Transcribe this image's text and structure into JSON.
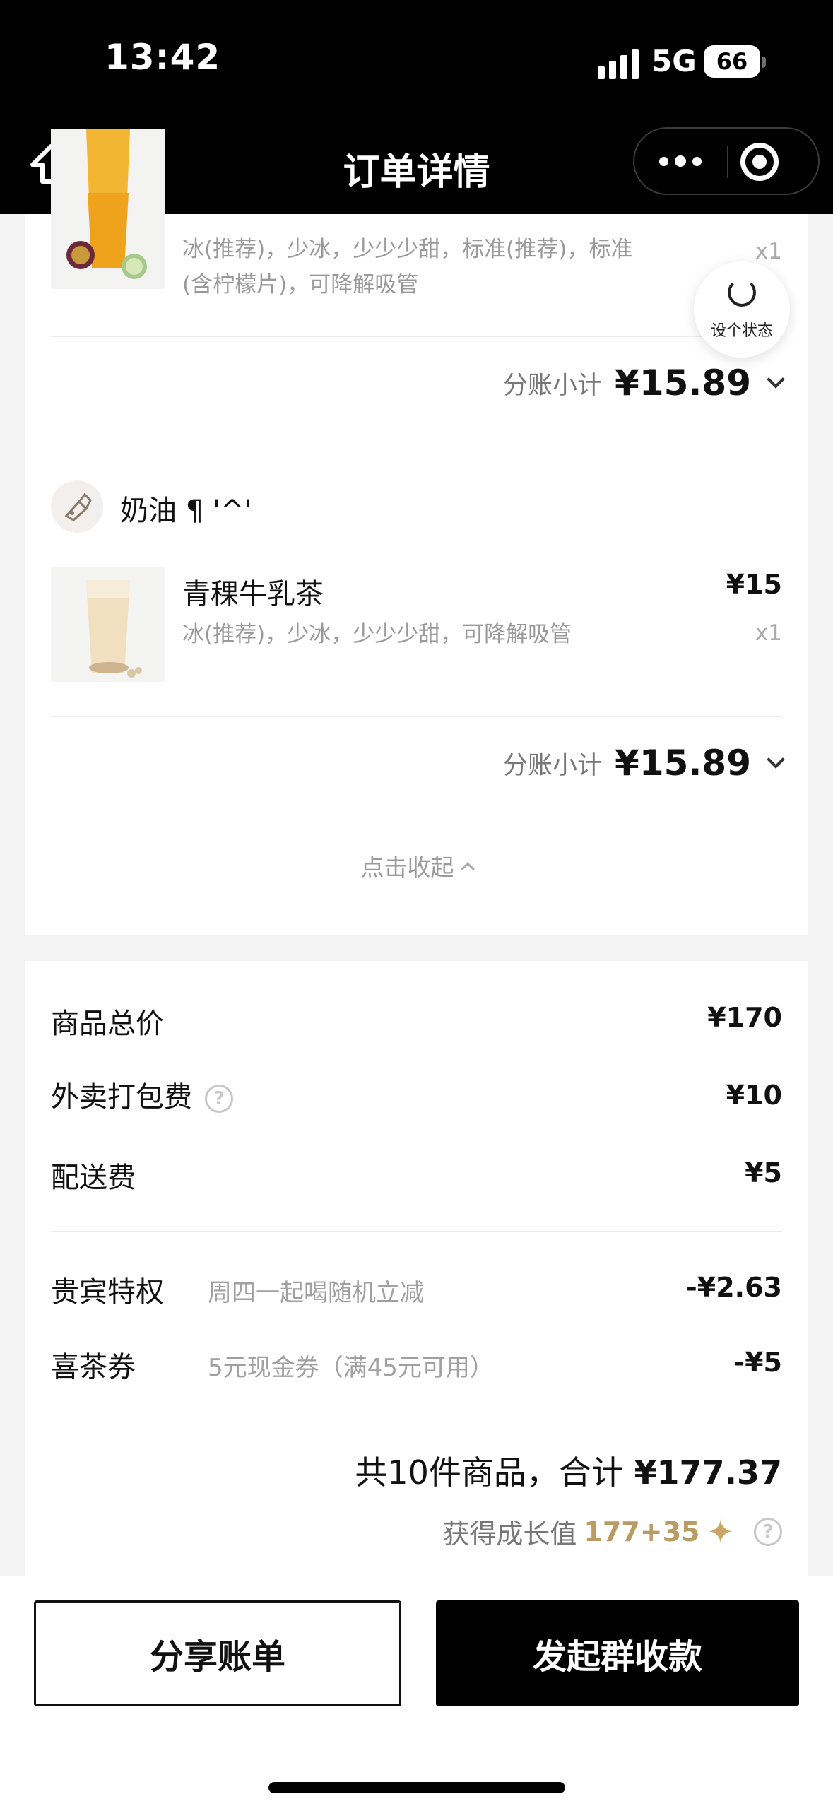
{
  "status_bar": {
    "time": "13:42",
    "network": "5G",
    "battery": "66"
  },
  "nav": {
    "title": "订单详情",
    "home_icon": "home-icon",
    "more_icon": "more-dots-icon",
    "close_icon": "target-close-icon"
  },
  "order": {
    "first_item": {
      "options_line1": "冰(推荐)，少冰，少少少甜，标准(推荐)，标准",
      "options_line2": "(含柠檬片)，可降解吸管",
      "qty": "x1"
    },
    "subtotal1": {
      "label": "分账小计",
      "value": "¥15.89"
    },
    "member": {
      "name": "奶油 ¶ '^'"
    },
    "second_item": {
      "name": "青稞牛乳茶",
      "price": "¥15",
      "options": "冰(推荐)，少冰，少少少甜，可降解吸管",
      "qty": "x1"
    },
    "subtotal2": {
      "label": "分账小计",
      "value": "¥15.89"
    },
    "collapse_label": "点击收起"
  },
  "floating_status": {
    "label": "设个状态"
  },
  "summary": {
    "goods_total": {
      "label": "商品总价",
      "value": "¥170"
    },
    "packing_fee": {
      "label": "外卖打包费",
      "value": "¥10",
      "help": "?"
    },
    "delivery_fee": {
      "label": "配送费",
      "value": "¥5"
    },
    "vip_privilege": {
      "label": "贵宾特权",
      "desc": "周四一起喝随机立减",
      "value": "-¥2.63"
    },
    "coupon": {
      "label": "喜茶券",
      "desc": "5元现金券（满45元可用）",
      "value": "-¥5"
    },
    "total_prefix": "共10件商品，合计 ",
    "total_value": "¥177.37",
    "growth_label": "获得成长值",
    "growth_value": "177+35",
    "growth_help": "?"
  },
  "actions": {
    "share": "分享账单",
    "collect": "发起群收款"
  }
}
